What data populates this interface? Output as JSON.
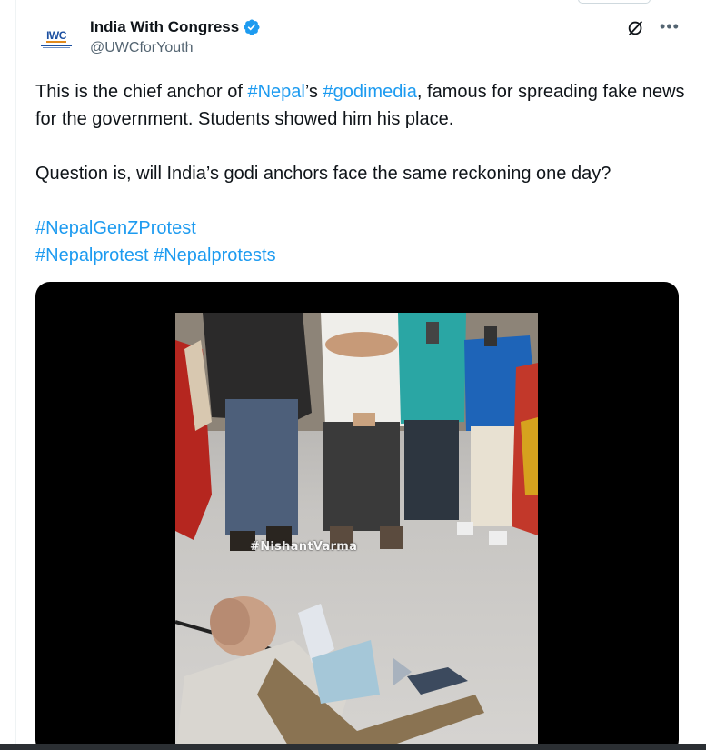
{
  "author": {
    "display_name": "India With Congress",
    "handle": "@UWCforYouth",
    "avatar_text": "IWC"
  },
  "tweet": {
    "line1_a": "This is the chief anchor of ",
    "line1_tag1": "#Nepal",
    "line1_b": "’s ",
    "line1_tag2": "#godimedia",
    "line1_c": ", famous for spreading fake news for the government. Students showed him his place.",
    "line2": "Question is, will India’s godi anchors face the same reckoning one day?",
    "hashtag_1": "#NepalGenZProtest",
    "hashtag_2": "#Nepalprotest",
    "hashtag_3": "#Nepalprotests"
  },
  "media": {
    "watermark": "#NishantVarma"
  },
  "icons": {
    "verified": "verified-badge-icon",
    "grok": "grok-icon",
    "more": "more-icon"
  },
  "colors": {
    "link": "#1d9bf0",
    "text": "#0f1419",
    "secondary": "#536471",
    "verified": "#1d9bf0"
  }
}
